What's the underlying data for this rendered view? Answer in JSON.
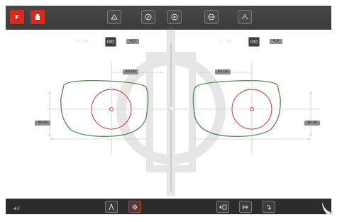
{
  "top_bar": {
    "left_buttons": [
      {
        "name": "fast-mode-button",
        "label": "F"
      },
      {
        "name": "tracer-button",
        "label": ""
      }
    ],
    "tools": [
      {
        "name": "bevel-tool-icon"
      },
      {
        "name": "groove-tool-icon"
      },
      {
        "name": "polish-tool-icon"
      },
      {
        "name": "drill-tool-icon"
      },
      {
        "name": "safety-bevel-tool-icon"
      }
    ]
  },
  "lens_right": {
    "pd_label": "Pₓ : 61",
    "pd_value": "4.0",
    "width_value": "53.00",
    "height_value": "30.00",
    "side_label": "R"
  },
  "lens_left": {
    "pd_label": "Pₓ : 61",
    "pd_value": "4.0",
    "width_value": "53.00",
    "height_value": "30.00",
    "side_label": "L"
  },
  "bottom_bar": {
    "job_number": "#3",
    "buttons": [
      {
        "name": "measure-tool-icon"
      },
      {
        "name": "center-tool-icon"
      },
      {
        "name": "edit-shape-icon"
      },
      {
        "name": "next-step-icon"
      },
      {
        "name": "finish-icon"
      }
    ]
  },
  "colors": {
    "frame_outline": "#4f8a55",
    "optical_center": "#c9302a",
    "accent": "#d62a1f"
  }
}
